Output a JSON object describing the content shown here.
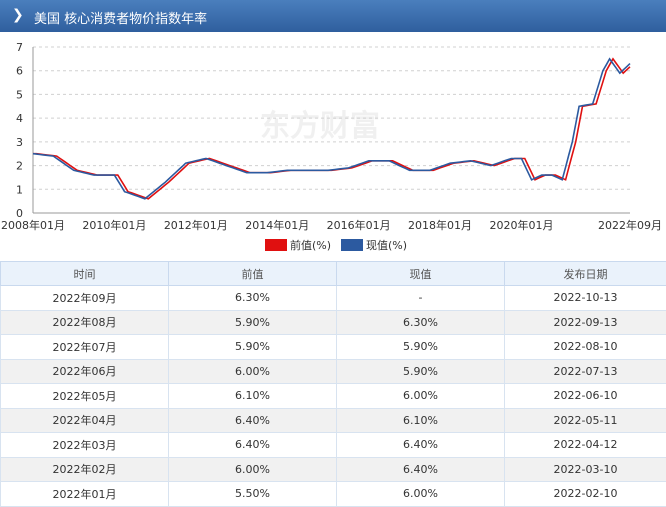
{
  "header": {
    "title": "美国 核心消费者物价指数年率"
  },
  "legend": {
    "prev_label": "前值(%)",
    "curr_label": "现值(%)",
    "prev_color": "#e01010",
    "curr_color": "#2c5aa0"
  },
  "watermark": "东方财富",
  "chart_data": {
    "type": "line",
    "ylim": [
      0,
      7
    ],
    "yticks": [
      0,
      1,
      2,
      3,
      4,
      5,
      6,
      7
    ],
    "x_range": [
      "2008-01",
      "2022-09"
    ],
    "xtick_labels": [
      "2008年01月",
      "2010年01月",
      "2012年01月",
      "2014年01月",
      "2016年01月",
      "2018年01月",
      "2020年01月",
      "2022年09月"
    ],
    "grid": true,
    "series": [
      {
        "name": "前值(%)",
        "color": "#e01010",
        "lag_months": 1
      },
      {
        "name": "现值(%)",
        "color": "#2c5aa0",
        "lag_months": 0
      }
    ],
    "x": [
      "2008-01",
      "2008-07",
      "2009-01",
      "2009-07",
      "2010-01",
      "2010-04",
      "2010-10",
      "2011-04",
      "2011-10",
      "2012-04",
      "2012-10",
      "2013-04",
      "2013-10",
      "2014-04",
      "2014-10",
      "2015-04",
      "2015-10",
      "2016-04",
      "2016-10",
      "2017-04",
      "2017-10",
      "2018-04",
      "2018-10",
      "2019-04",
      "2019-10",
      "2020-01",
      "2020-04",
      "2020-07",
      "2020-10",
      "2021-01",
      "2021-04",
      "2021-06",
      "2021-10",
      "2022-01",
      "2022-03",
      "2022-06",
      "2022-09"
    ],
    "values": [
      2.5,
      2.4,
      1.8,
      1.6,
      1.6,
      0.9,
      0.6,
      1.3,
      2.1,
      2.3,
      2.0,
      1.7,
      1.7,
      1.8,
      1.8,
      1.8,
      1.9,
      2.2,
      2.2,
      1.8,
      1.8,
      2.1,
      2.2,
      2.0,
      2.3,
      2.3,
      1.4,
      1.6,
      1.6,
      1.4,
      3.0,
      4.5,
      4.6,
      6.0,
      6.5,
      5.9,
      6.3
    ]
  },
  "table": {
    "headers": [
      "时间",
      "前值",
      "现值",
      "发布日期"
    ],
    "rows": [
      [
        "2022年09月",
        "6.30%",
        "-",
        "2022-10-13"
      ],
      [
        "2022年08月",
        "5.90%",
        "6.30%",
        "2022-09-13"
      ],
      [
        "2022年07月",
        "5.90%",
        "5.90%",
        "2022-08-10"
      ],
      [
        "2022年06月",
        "6.00%",
        "5.90%",
        "2022-07-13"
      ],
      [
        "2022年05月",
        "6.10%",
        "6.00%",
        "2022-06-10"
      ],
      [
        "2022年04月",
        "6.40%",
        "6.10%",
        "2022-05-11"
      ],
      [
        "2022年03月",
        "6.40%",
        "6.40%",
        "2022-04-12"
      ],
      [
        "2022年02月",
        "6.00%",
        "6.40%",
        "2022-03-10"
      ],
      [
        "2022年01月",
        "5.50%",
        "6.00%",
        "2022-02-10"
      ]
    ]
  }
}
